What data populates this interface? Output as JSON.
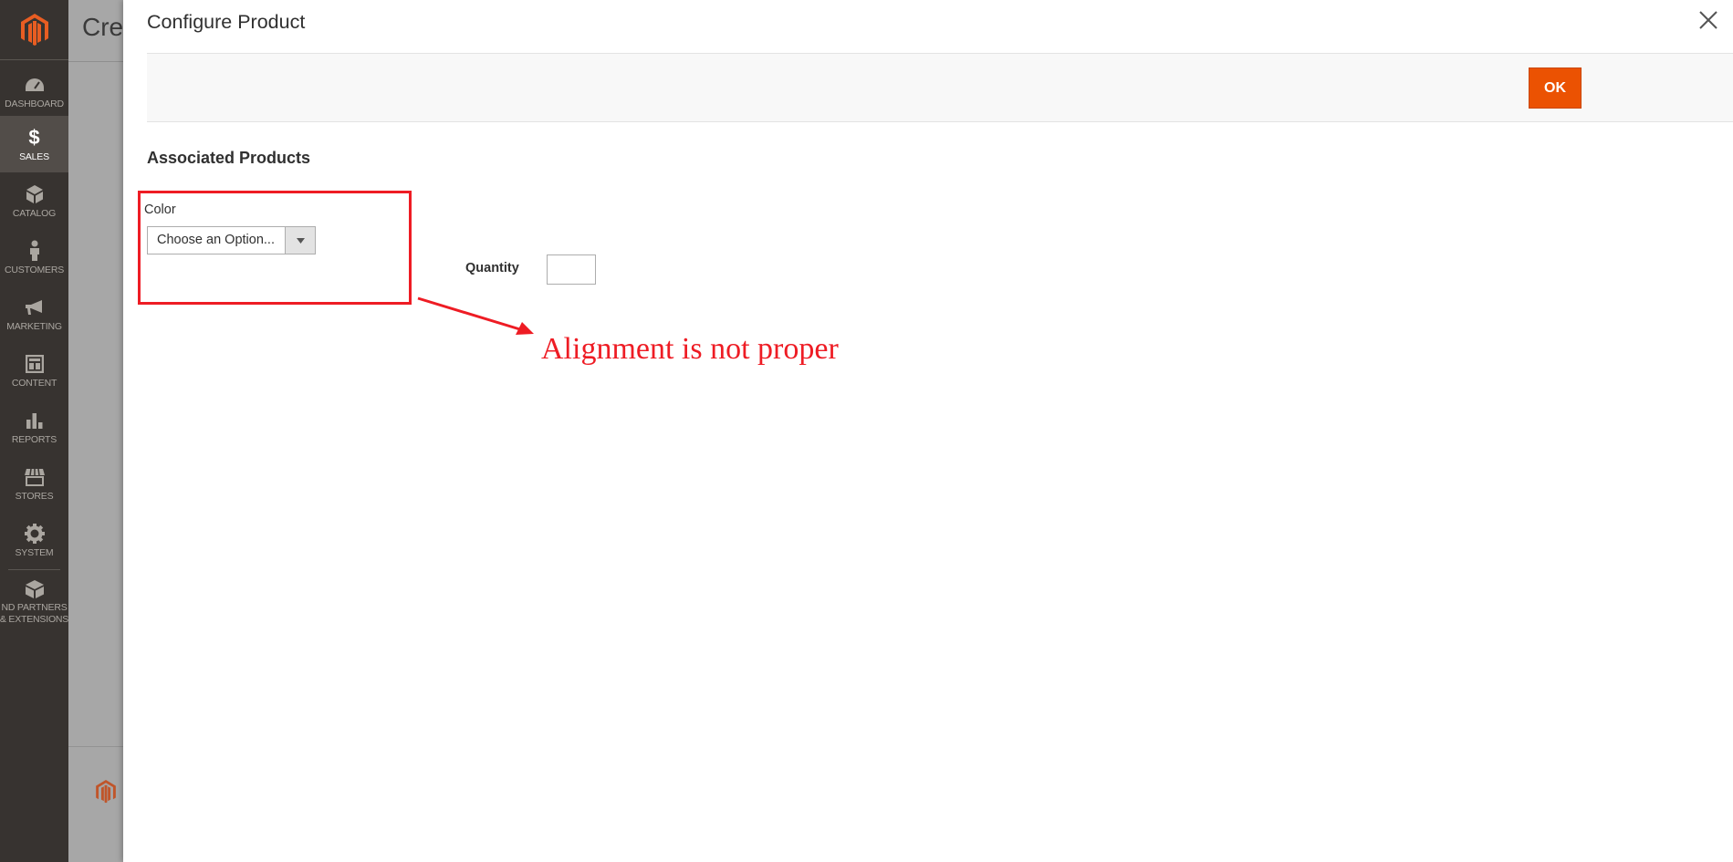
{
  "sidebar": {
    "items": [
      {
        "label": "DASHBOARD",
        "icon": "dashboard-icon"
      },
      {
        "label": "SALES",
        "icon": "dollar-icon",
        "active": true
      },
      {
        "label": "CATALOG",
        "icon": "cube-icon"
      },
      {
        "label": "CUSTOMERS",
        "icon": "person-icon"
      },
      {
        "label": "MARKETING",
        "icon": "megaphone-icon"
      },
      {
        "label": "CONTENT",
        "icon": "layout-icon"
      },
      {
        "label": "REPORTS",
        "icon": "bar-chart-icon"
      },
      {
        "label": "STORES",
        "icon": "storefront-icon"
      },
      {
        "label": "SYSTEM",
        "icon": "gear-icon"
      }
    ],
    "partners_line1": "ND PARTNERS",
    "partners_line2": "& EXTENSIONS"
  },
  "background_page": {
    "title": "Cre"
  },
  "modal": {
    "title": "Configure Product",
    "ok_label": "OK",
    "section_title": "Associated Products",
    "color_label": "Color",
    "color_select_value": "Choose an Option...",
    "quantity_label": "Quantity",
    "quantity_value": ""
  },
  "annotation": {
    "text": "Alignment is not proper",
    "color": "#ee1c24"
  },
  "colors": {
    "sidebar_bg": "#373330",
    "accent": "#eb5202",
    "brand": "#e85d22"
  }
}
